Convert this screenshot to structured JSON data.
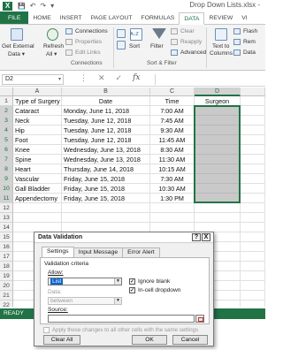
{
  "app": {
    "logo": "X",
    "doc_title": "Drop Down Lists.xlsx -"
  },
  "quick_access": {
    "save": "💾",
    "undo": "↶",
    "redo": "↷",
    "more": "▾"
  },
  "ribbon_tabs": [
    "FILE",
    "HOME",
    "INSERT",
    "PAGE LAYOUT",
    "FORMULAS",
    "DATA",
    "REVIEW",
    "VI"
  ],
  "active_tab": "DATA",
  "ribbon": {
    "get_external": "Get External",
    "get_external_2": "Data ▾",
    "refresh": "Refresh",
    "refresh_2": "All ▾",
    "connections": "Connections",
    "properties": "Properties",
    "edit_links": "Edit Links",
    "connections_group": "Connections",
    "sort_az": "A↓Z",
    "sort": "Sort",
    "filter": "Filter",
    "clear": "Clear",
    "reapply": "Reapply",
    "advanced": "Advanced",
    "sort_filter_group": "Sort & Filter",
    "text_to_columns": "Text to",
    "text_to_columns_2": "Columns",
    "flash": "Flash",
    "remove": "Rem",
    "data_val": "Data"
  },
  "formula_bar": {
    "name_box": "D2",
    "dropdown": "▾",
    "cancel": "✕",
    "enter": "✓",
    "fx": "fx",
    "dots": "⋮",
    "value": ""
  },
  "columns": [
    "A",
    "B",
    "C",
    "D"
  ],
  "headers": [
    "Type of Surgery",
    "Date",
    "Time",
    "Surgeon"
  ],
  "rows": [
    {
      "n": "1"
    },
    {
      "n": "2",
      "a": "Cataract",
      "b": "Monday, June 11, 2018",
      "c": "7:00 AM"
    },
    {
      "n": "3",
      "a": "Neck",
      "b": "Tuesday, June 12, 2018",
      "c": "7:45 AM"
    },
    {
      "n": "4",
      "a": "Hip",
      "b": "Tuesday, June 12, 2018",
      "c": "9:30 AM"
    },
    {
      "n": "5",
      "a": "Foot",
      "b": "Tuesday, June 12, 2018",
      "c": "11:45 AM"
    },
    {
      "n": "6",
      "a": "Knee",
      "b": "Wednesday, June 13, 2018",
      "c": "8:30 AM"
    },
    {
      "n": "7",
      "a": "Spine",
      "b": "Wednesday, June 13, 2018",
      "c": "11:30 AM"
    },
    {
      "n": "8",
      "a": "Heart",
      "b": "Thursday, June 14, 2018",
      "c": "10:15 AM"
    },
    {
      "n": "9",
      "a": "Vascular",
      "b": "Friday, June 15, 2018",
      "c": "7:30 AM"
    },
    {
      "n": "10",
      "a": "Gall Bladder",
      "b": "Friday, June 15, 2018",
      "c": "10:30 AM"
    },
    {
      "n": "11",
      "a": "Appendectomy",
      "b": "Friday, June 15, 2018",
      "c": "1:30 PM"
    },
    {
      "n": "12"
    },
    {
      "n": "13"
    },
    {
      "n": "14"
    },
    {
      "n": "15"
    },
    {
      "n": "16"
    },
    {
      "n": "17"
    },
    {
      "n": "18"
    },
    {
      "n": "19"
    },
    {
      "n": "20"
    },
    {
      "n": "21"
    },
    {
      "n": "22"
    }
  ],
  "status": "READY",
  "dialog": {
    "title": "Data Validation",
    "help": "?",
    "close": "X",
    "tabs": [
      "Settings",
      "Input Message",
      "Error Alert"
    ],
    "active_tab": "Settings",
    "criteria_label": "Validation criteria",
    "allow_label": "Allow:",
    "allow_value": "List",
    "ignore_blank": "Ignore blank",
    "ignore_blank_checked": true,
    "incell_dropdown": "In-cell dropdown",
    "incell_checked": true,
    "data_label": "Data:",
    "data_value": "between",
    "source_label": "Source:",
    "source_value": "",
    "apply_all": "Apply these changes to all other cells with the same settings",
    "clear_all": "Clear All",
    "ok": "OK",
    "cancel": "Cancel"
  },
  "colors": {
    "excel_green": "#217346",
    "selection_gray": "#c9c9c9"
  }
}
